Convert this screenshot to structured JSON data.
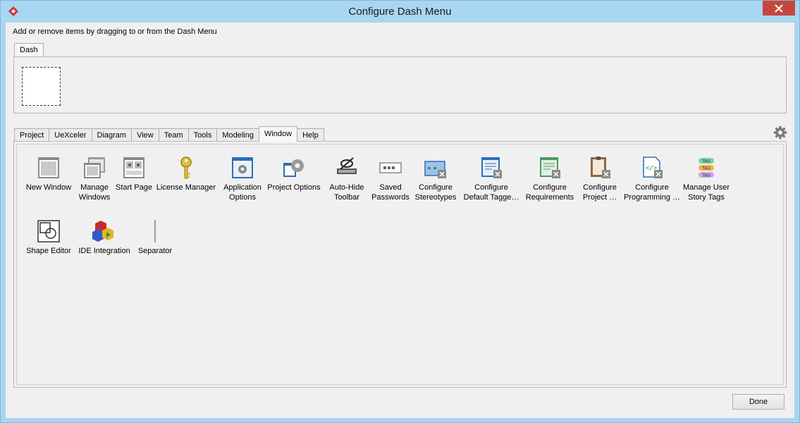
{
  "window": {
    "title": "Configure Dash Menu"
  },
  "instructions": "Add or remove items by dragging to or from the Dash Menu",
  "dash": {
    "tab_label": "Dash"
  },
  "tabs": [
    {
      "label": "Project"
    },
    {
      "label": "UeXceler"
    },
    {
      "label": "Diagram"
    },
    {
      "label": "View"
    },
    {
      "label": "Team"
    },
    {
      "label": "Tools"
    },
    {
      "label": "Modeling"
    },
    {
      "label": "Window",
      "active": true
    },
    {
      "label": "Help"
    }
  ],
  "items": [
    {
      "line1": "New Window",
      "line2": "",
      "icon": "new-window-icon"
    },
    {
      "line1": "Manage",
      "line2": "Windows",
      "icon": "manage-windows-icon"
    },
    {
      "line1": "Start Page",
      "line2": "",
      "icon": "start-page-icon"
    },
    {
      "line1": "License Manager",
      "line2": "",
      "icon": "key-icon"
    },
    {
      "line1": "Application",
      "line2": "Options",
      "icon": "application-options-icon"
    },
    {
      "line1": "Project Options",
      "line2": "",
      "icon": "project-options-icon"
    },
    {
      "line1": "Auto-Hide",
      "line2": "Toolbar",
      "icon": "auto-hide-toolbar-icon"
    },
    {
      "line1": "Saved",
      "line2": "Passwords",
      "icon": "saved-passwords-icon"
    },
    {
      "line1": "Configure",
      "line2": "Stereotypes",
      "icon": "configure-stereotypes-icon"
    },
    {
      "line1": "Configure",
      "line2": "Default Tagge…",
      "icon": "configure-tagged-values-icon"
    },
    {
      "line1": "Configure",
      "line2": "Requirements",
      "icon": "configure-requirements-icon"
    },
    {
      "line1": "Configure",
      "line2": "Project …",
      "icon": "configure-project-icon"
    },
    {
      "line1": "Configure",
      "line2": "Programming …",
      "icon": "configure-programming-icon"
    },
    {
      "line1": "Manage User",
      "line2": "Story Tags",
      "icon": "story-tags-icon"
    },
    {
      "line1": "Shape Editor",
      "line2": "",
      "icon": "shape-editor-icon"
    },
    {
      "line1": "IDE Integration",
      "line2": "",
      "icon": "ide-integration-icon"
    },
    {
      "line1": "Separator",
      "line2": "",
      "icon": "separator-icon"
    }
  ],
  "story_tags": [
    "TAG",
    "TAG",
    "TAG"
  ],
  "done_label": "Done",
  "colors": {
    "titlebar": "#a9d6f2",
    "close": "#c7463c",
    "client": "#f0f0f0"
  }
}
